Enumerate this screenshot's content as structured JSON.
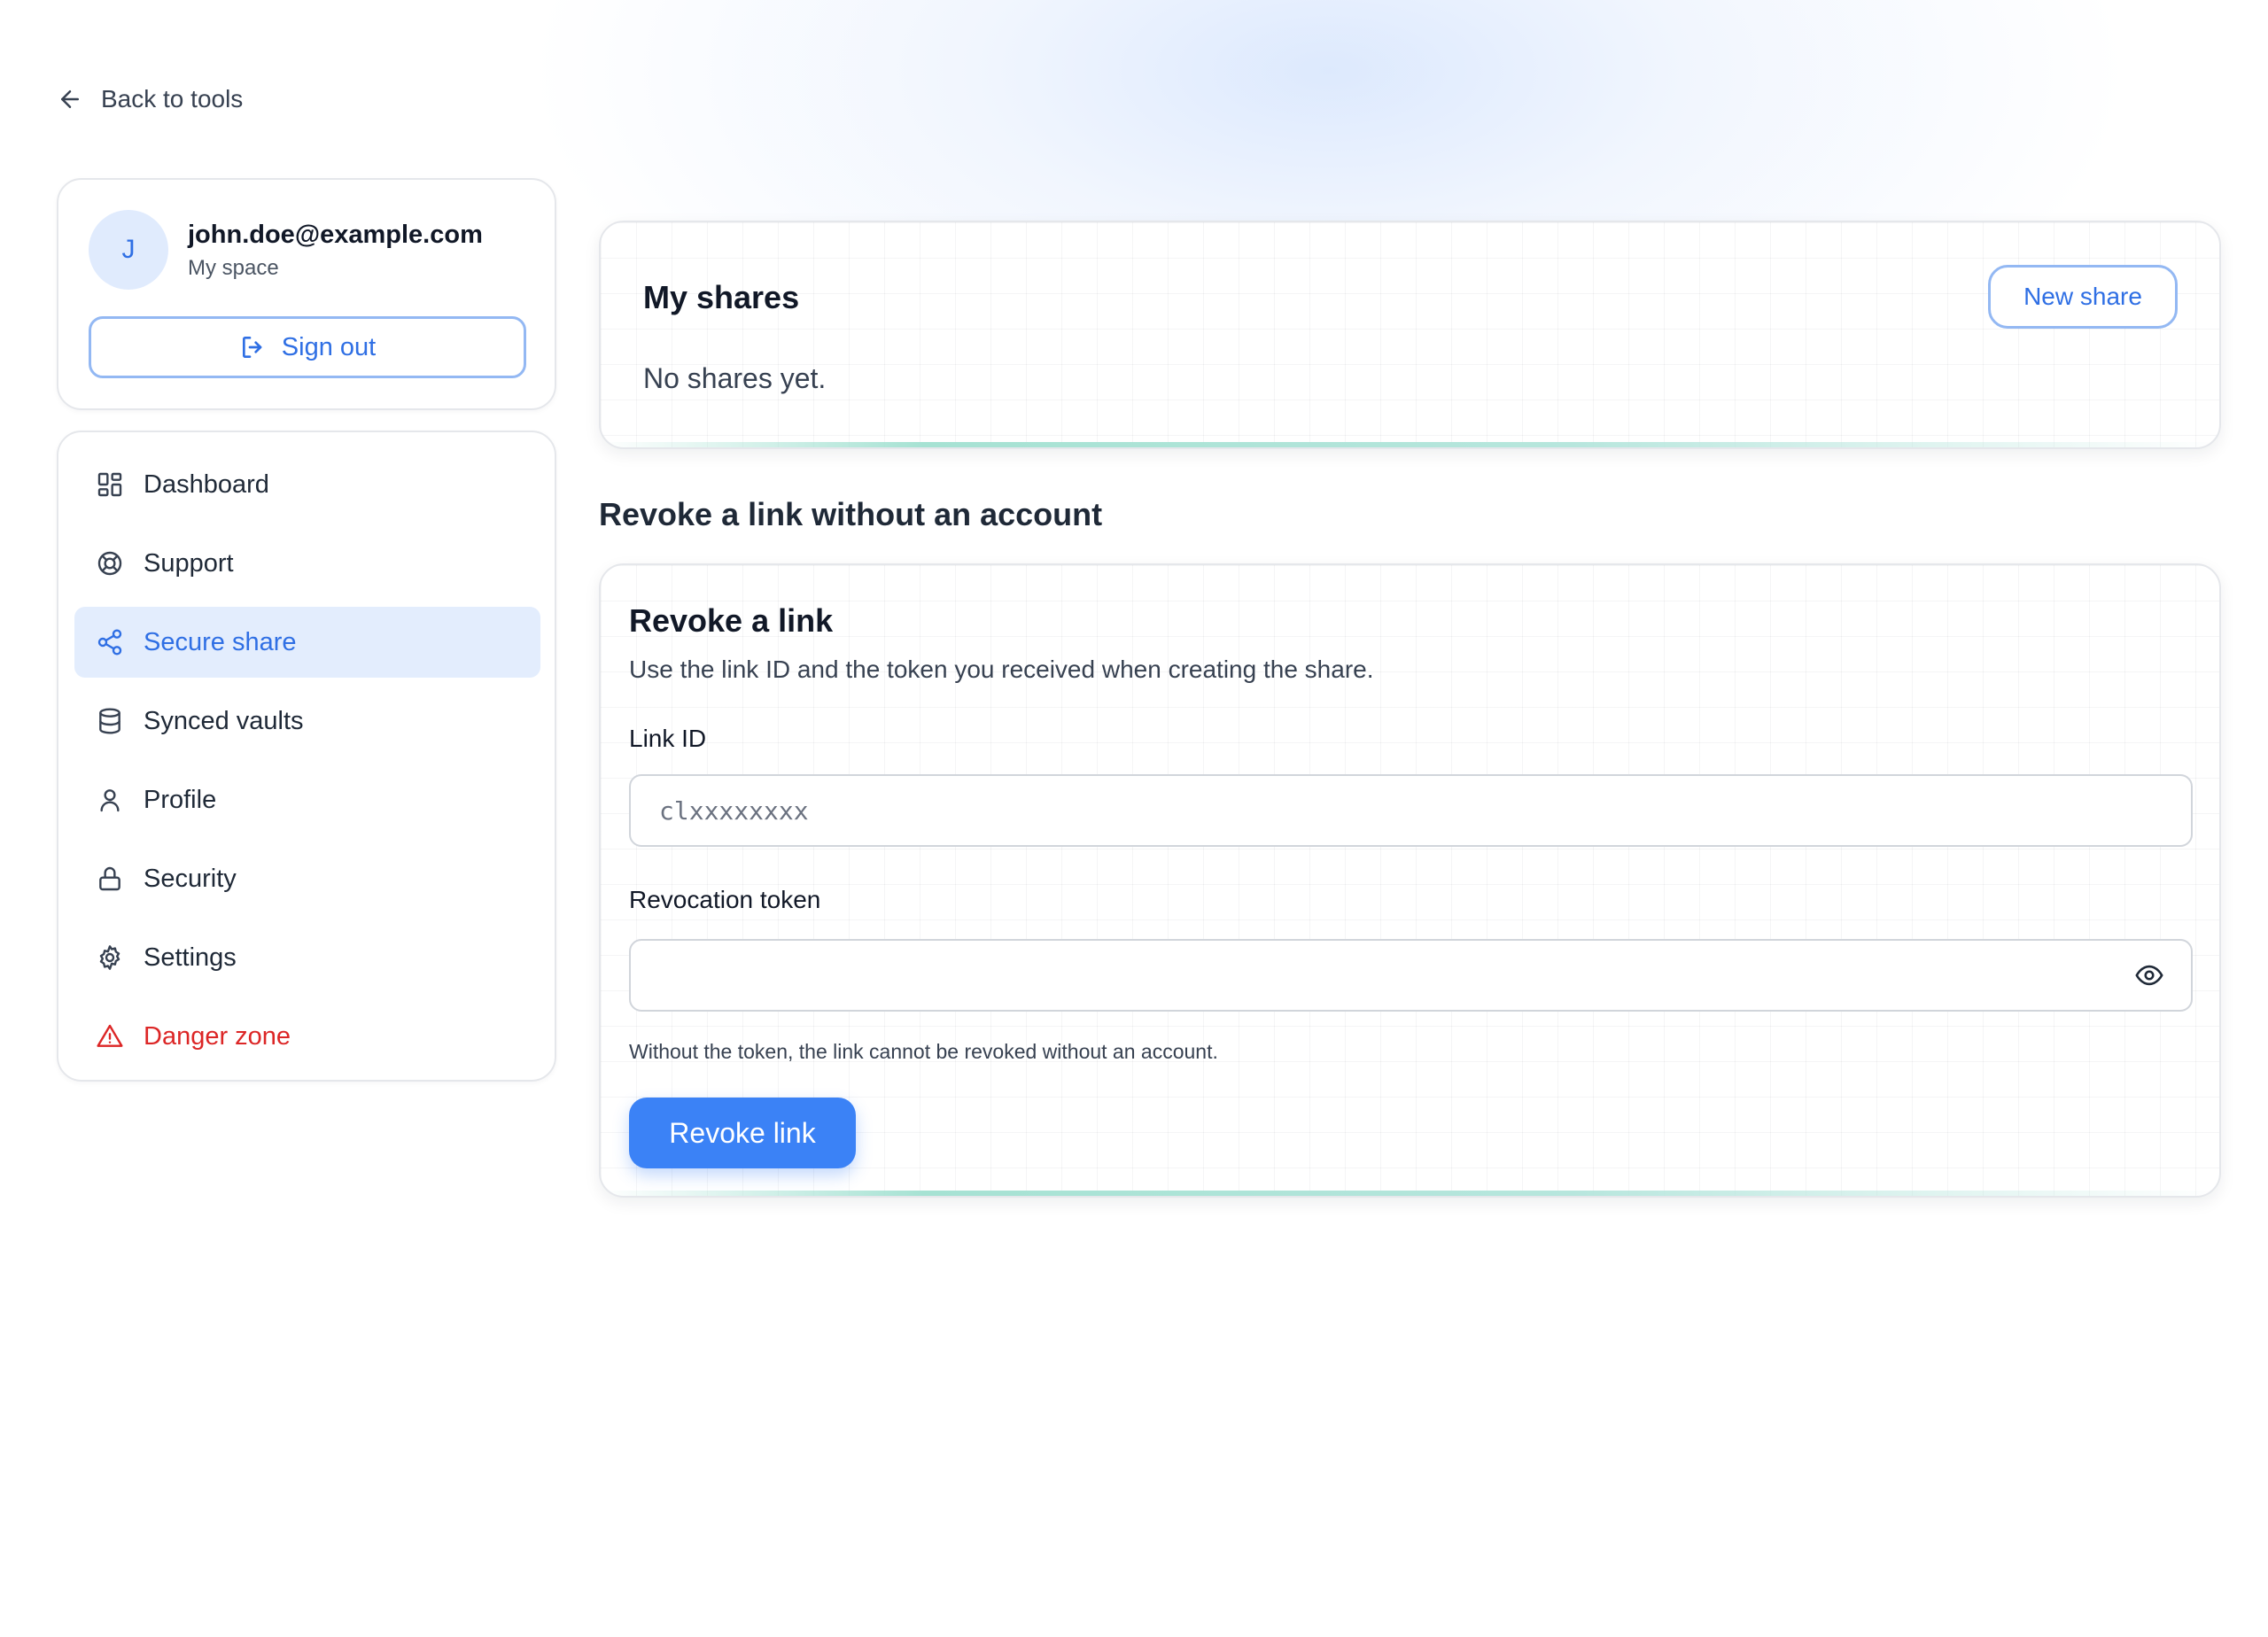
{
  "nav_back": {
    "label": "Back to tools"
  },
  "account": {
    "avatar_initial": "J",
    "email": "john.doe@example.com",
    "space": "My space",
    "sign_out_label": "Sign out"
  },
  "sidebar": {
    "items": [
      {
        "label": "Dashboard",
        "icon": "dashboard-icon",
        "active": false
      },
      {
        "label": "Support",
        "icon": "lifebuoy-icon",
        "active": false
      },
      {
        "label": "Secure share",
        "icon": "share-icon",
        "active": true
      },
      {
        "label": "Synced vaults",
        "icon": "database-icon",
        "active": false
      },
      {
        "label": "Profile",
        "icon": "user-icon",
        "active": false
      },
      {
        "label": "Security",
        "icon": "lock-icon",
        "active": false
      },
      {
        "label": "Settings",
        "icon": "gear-icon",
        "active": false
      },
      {
        "label": "Danger zone",
        "icon": "warning-icon",
        "active": false
      }
    ]
  },
  "shares": {
    "title": "My shares",
    "empty_text": "No shares yet.",
    "new_share_label": "New share"
  },
  "revoke_section": {
    "heading": "Revoke a link without an account",
    "card_title": "Revoke a link",
    "description": "Use the link ID and the token you received when creating the share.",
    "link_id_label": "Link ID",
    "link_id_value": "",
    "link_id_placeholder": "clxxxxxxxx",
    "token_label": "Revocation token",
    "token_value": "",
    "help_text": "Without the token, the link cannot be revoked without an account.",
    "revoke_button_label": "Revoke link"
  },
  "colors": {
    "accent": "#2f6fe4",
    "primary_button": "#3b82f6",
    "danger": "#dc2626",
    "active_bg": "#e3edfd"
  }
}
